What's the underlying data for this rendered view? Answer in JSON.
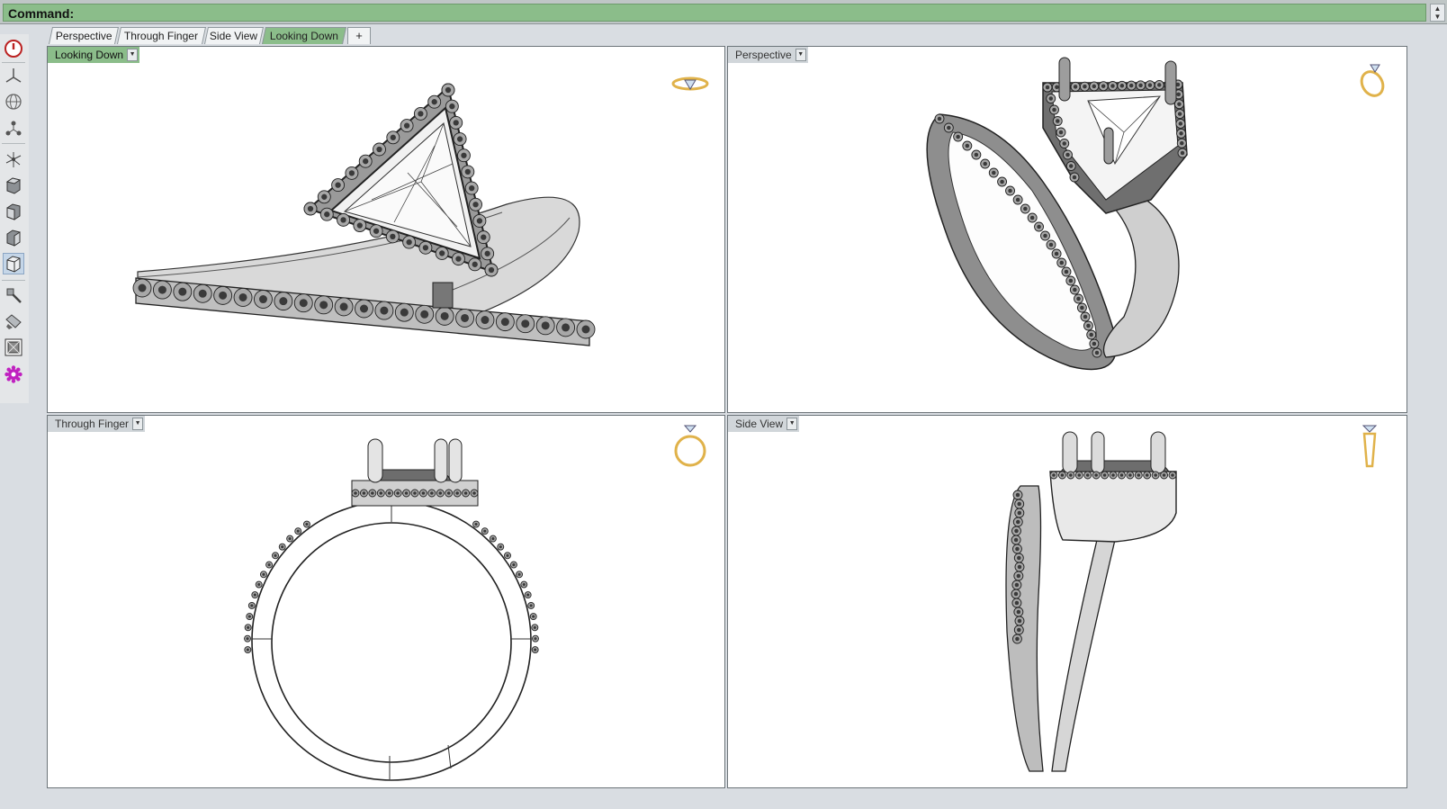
{
  "command": {
    "label": "Command:"
  },
  "tabs": [
    {
      "label": "Perspective"
    },
    {
      "label": "Through Finger"
    },
    {
      "label": "Side View"
    },
    {
      "label": "Looking Down"
    },
    {
      "label": "+"
    }
  ],
  "viewports": {
    "looking_down": {
      "title": "Looking Down"
    },
    "perspective": {
      "title": "Perspective"
    },
    "through_finger": {
      "title": "Through Finger"
    },
    "side_view": {
      "title": "Side View"
    }
  },
  "colors": {
    "active_green": "#8bbd8a",
    "accent_gold": "#e0b24a",
    "toolbar_bg": "#e4e6e8"
  },
  "toolbar": {
    "items": [
      "power-icon",
      "axes-icon",
      "globe-icon",
      "nodes-icon",
      "gumball-icon",
      "box-top-icon",
      "box-front-icon",
      "box-side-icon",
      "box-perspective-icon",
      "brush-icon",
      "paint-icon",
      "render-icon",
      "gear-icon"
    ]
  }
}
